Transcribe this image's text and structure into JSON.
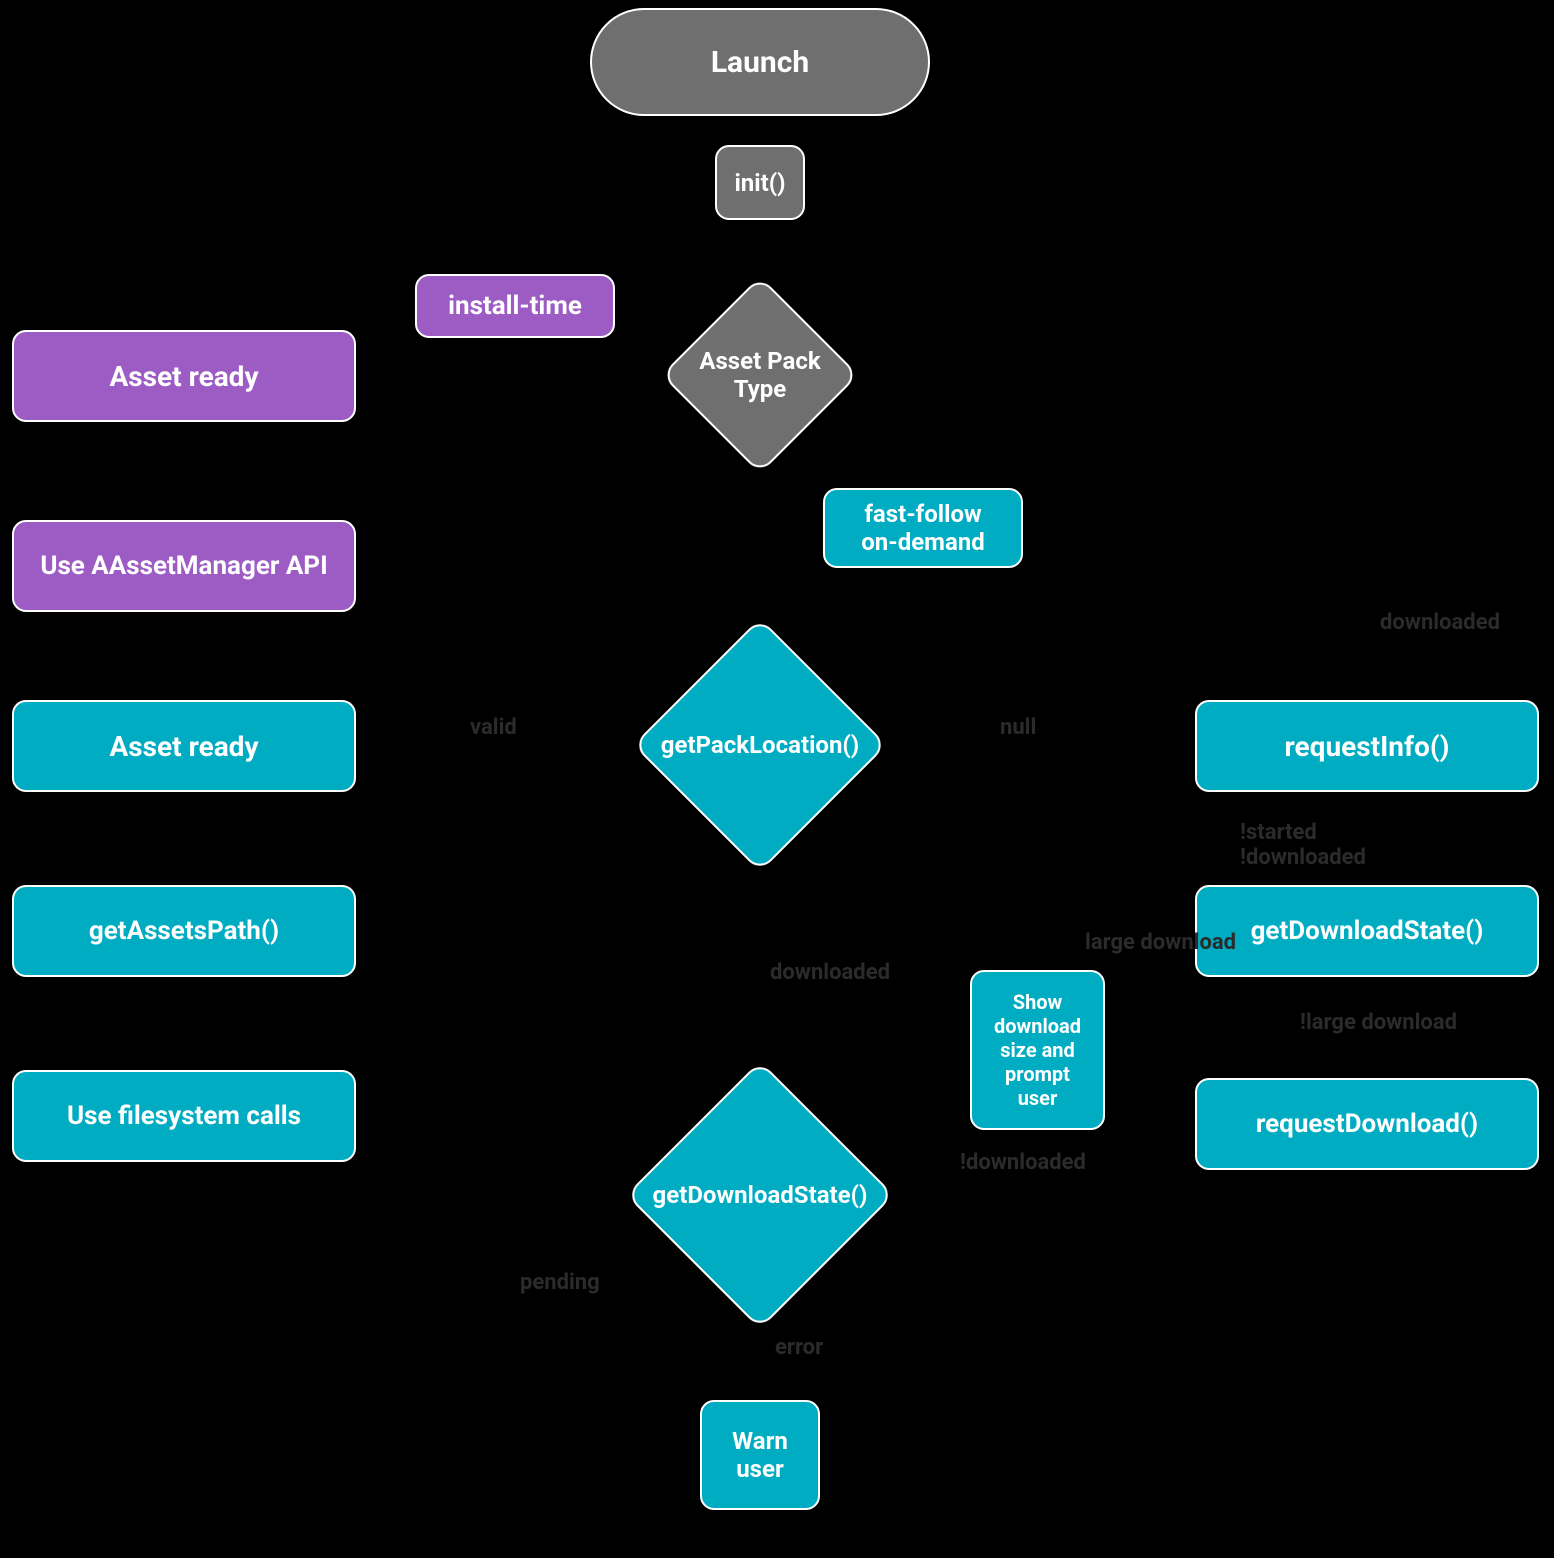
{
  "nodes": {
    "launch": "Launch",
    "init": "init()",
    "assetPackType": "Asset Pack\nType",
    "installTime": "install-time",
    "assetReadyPurple": "Asset ready",
    "useAAssetManager": "Use AAssetManager API",
    "fastFollowOnDemand": "fast-follow\non-demand",
    "getPackLocation": "getPackLocation()",
    "assetReadyTeal": "Asset ready",
    "getAssetsPath": "getAssetsPath()",
    "useFilesystem": "Use filesystem calls",
    "requestInfo": "requestInfo()",
    "getDownloadState1": "getDownloadState()",
    "showDownloadSize": "Show\ndownload\nsize and\nprompt\nuser",
    "requestDownload": "requestDownload()",
    "getDownloadState2": "getDownloadState()",
    "warnUser": "Warn\nuser"
  },
  "edges": {
    "valid": "valid",
    "null": "null",
    "notStarted": "!started\n!downloaded",
    "downloaded": "downloaded",
    "large": "large download",
    "notLarge": "!large download",
    "notDownloaded": "!downloaded",
    "pending": "pending",
    "error": "error"
  },
  "colors": {
    "gray": "#6f6f6f",
    "teal": "#00acc1",
    "purple": "#9c5cc4"
  }
}
